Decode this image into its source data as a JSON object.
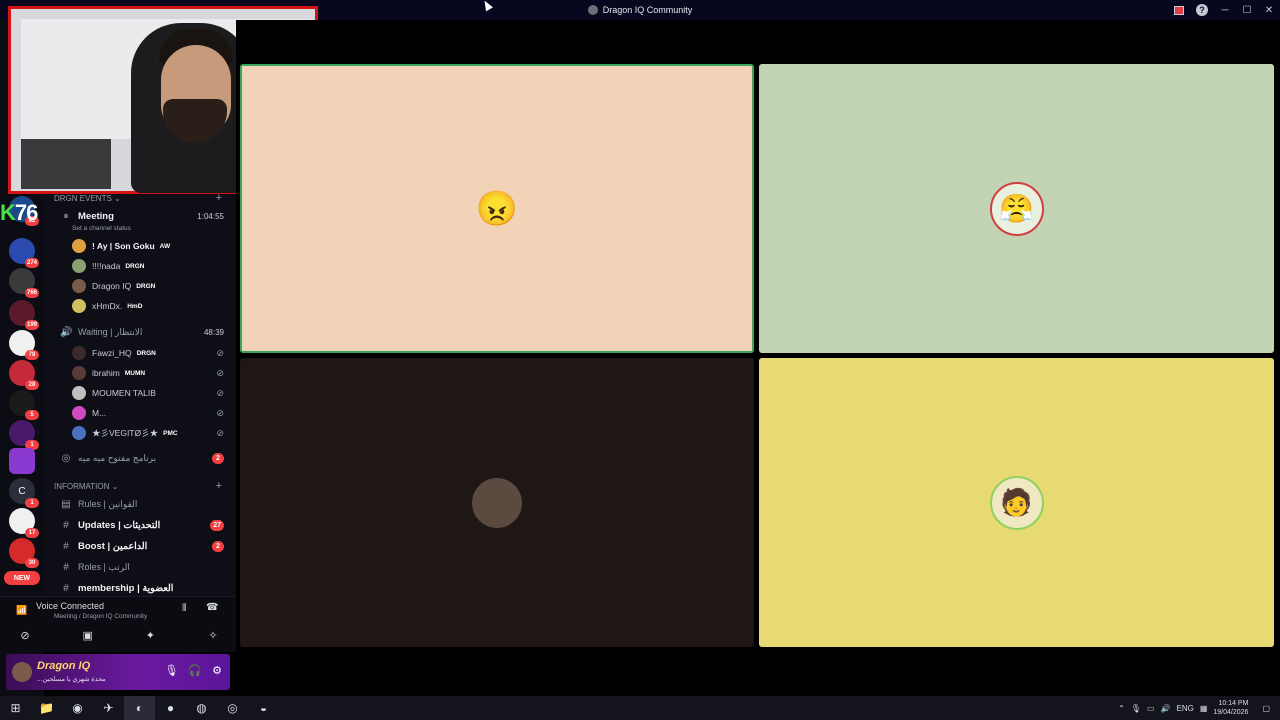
{
  "titlebar": {
    "title": "Dragon IQ Community"
  },
  "servers": {
    "badges": [
      "82",
      "274",
      "766",
      "199",
      "78",
      "28",
      "5",
      "1",
      "1",
      "17",
      "30",
      "16+"
    ],
    "letter_server": "C",
    "new_tag": "NEW",
    "overlay_text": "K76"
  },
  "channels": {
    "category_events": "DRGN Events",
    "meeting": {
      "name": "Meeting",
      "timer": "1:04:55",
      "status": "Set a channel status"
    },
    "meeting_users": [
      {
        "name": "! Ay | Son Goku",
        "tag": "AW"
      },
      {
        "name": "!!!!nada",
        "tag": "DRGN"
      },
      {
        "name": "Dragon IQ",
        "tag": "DRGN"
      },
      {
        "name": "xHmDx.",
        "tag": "HmD"
      }
    ],
    "waiting": {
      "name": "Waiting | الانتظار",
      "timer": "48:39"
    },
    "waiting_users": [
      {
        "name": "Fawzi_HQ",
        "tag": "DRGN"
      },
      {
        "name": "ibrahim",
        "tag": "MUMN"
      },
      {
        "name": "MOUMEN TALIB",
        "tag": ""
      },
      {
        "name": "M...",
        "tag": ""
      },
      {
        "name": "★彡VEGITØ彡★",
        "tag": "PMC"
      }
    ],
    "program": {
      "name": "برنامج مفتوح ميه ميه",
      "count": "2"
    },
    "category_info": "INFORMATION",
    "info_channels": [
      {
        "name": "Rules | القوانين",
        "count": ""
      },
      {
        "name": "Updates | التحديثات",
        "count": "27"
      },
      {
        "name": "Boost | الداعمين",
        "count": "2"
      },
      {
        "name": "Roles | الرتب",
        "count": ""
      },
      {
        "name": "membership | العضوية",
        "count": ""
      }
    ]
  },
  "voice": {
    "connected": "Voice Connected",
    "location": "Meeting / Dragon IQ Community"
  },
  "user_panel": {
    "name": "Dragon IQ",
    "status": "...محدة شهري يا مسلحين"
  },
  "taskbar": {
    "lang": "ENG",
    "time": "10:14 PM",
    "date": "19/04/2026"
  }
}
